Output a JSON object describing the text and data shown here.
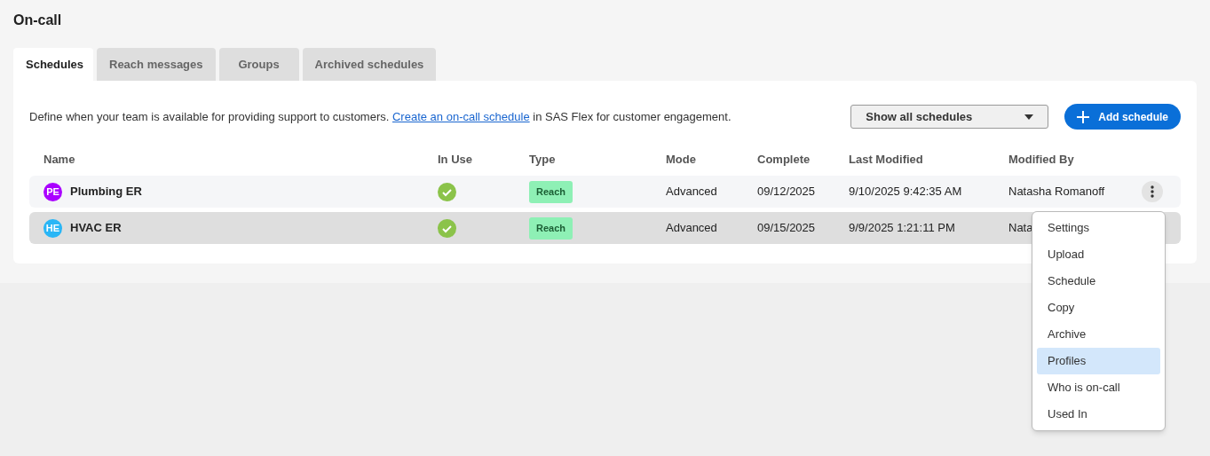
{
  "page_title": "On-call",
  "tabs": [
    {
      "label": "Schedules",
      "selected": true
    },
    {
      "label": "Reach messages",
      "selected": false
    },
    {
      "label": "Groups",
      "selected": false
    },
    {
      "label": "Archived schedules",
      "selected": false
    }
  ],
  "description": {
    "before": "Define when your team is available for providing support to customers. ",
    "link": "Create an on-call schedule",
    "after": " in SAS Flex for customer engagement."
  },
  "filter": {
    "value": "Show all schedules"
  },
  "add_button": "Add schedule",
  "table": {
    "columns": [
      "Name",
      "In Use",
      "Type",
      "Mode",
      "Complete",
      "Last Modified",
      "Modified By"
    ],
    "rows": [
      {
        "initials": "PE",
        "color": "#aa00ff",
        "name": "Plumbing ER",
        "in_use": true,
        "type": "Reach",
        "mode": "Advanced",
        "complete": "09/12/2025",
        "last_modified": "9/10/2025 9:42:35 AM",
        "modified_by": "Natasha Romanoff",
        "selected": false,
        "menu_button": true
      },
      {
        "initials": "HE",
        "color": "#29b6f6",
        "name": "HVAC ER",
        "in_use": true,
        "type": "Reach",
        "mode": "Advanced",
        "complete": "09/15/2025",
        "last_modified": "9/9/2025 1:21:11 PM",
        "modified_by": "Nata",
        "selected": true,
        "menu_button": false
      }
    ]
  },
  "menu": {
    "items": [
      {
        "label": "Settings",
        "selected": false
      },
      {
        "label": "Upload",
        "selected": false
      },
      {
        "label": "Schedule",
        "selected": false
      },
      {
        "label": "Copy",
        "selected": false
      },
      {
        "label": "Archive",
        "selected": false
      },
      {
        "label": "Profiles",
        "selected": true
      },
      {
        "label": "Who is on-call",
        "selected": false
      },
      {
        "label": "Used In",
        "selected": false
      }
    ]
  }
}
